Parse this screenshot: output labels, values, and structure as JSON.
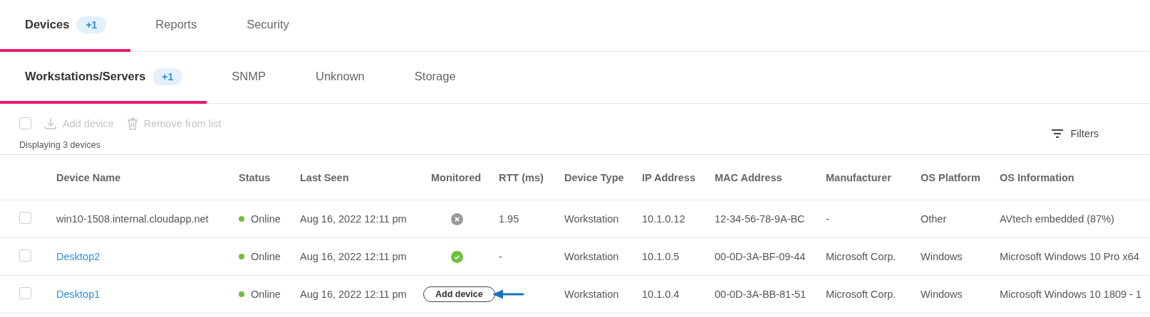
{
  "tabs": [
    {
      "label": "Devices",
      "badge": "+1",
      "selected": true
    },
    {
      "label": "Reports",
      "selected": false
    },
    {
      "label": "Security",
      "selected": false
    }
  ],
  "subtabs": [
    {
      "label": "Workstations/Servers",
      "badge": "+1",
      "selected": true
    },
    {
      "label": "SNMP",
      "selected": false
    },
    {
      "label": "Unknown",
      "selected": false
    },
    {
      "label": "Storage",
      "selected": false
    }
  ],
  "toolbar": {
    "select_all_checked": false,
    "actions": [
      {
        "kind": "add",
        "label": "Add device",
        "disabled": true
      },
      {
        "kind": "remove",
        "label": "Remove from list",
        "disabled": true
      }
    ],
    "count": "Displaying 3 devices",
    "filters": "Filters"
  },
  "table": {
    "columns": [
      "Device Name",
      "Status",
      "Last Seen",
      "Monitored",
      "RTT (ms)",
      "Device Type",
      "IP Address",
      "MAC Address",
      "Manufacturer",
      "OS Platform",
      "OS Information"
    ],
    "rows": [
      {
        "checked": false,
        "name": "win10-1508.internal.cloudapp.net",
        "link": false,
        "status": "Online",
        "last_seen": "Aug 16, 2022 12:11 pm",
        "monitored": {
          "kind": "not_monitored"
        },
        "rtt": "1.95",
        "device_type": "Workstation",
        "ip": "10.1.0.12",
        "mac": "12-34-56-78-9A-BC",
        "manufacturer": "-",
        "os_platform": "Other",
        "os_info": "AVtech embedded (87%)"
      },
      {
        "checked": false,
        "name": "Desktop2",
        "link": true,
        "status": "Online",
        "last_seen": "Aug 16, 2022 12:11 pm",
        "monitored": {
          "kind": "monitored"
        },
        "rtt": "-",
        "device_type": "Workstation",
        "ip": "10.1.0.5",
        "mac": "00-0D-3A-BF-09-44",
        "manufacturer": "Microsoft Corp.",
        "os_platform": "Windows",
        "os_info": "Microsoft Windows 10 Pro x64"
      },
      {
        "checked": false,
        "name": "Desktop1",
        "link": true,
        "status": "Online",
        "last_seen": "Aug 16, 2022 12:11 pm",
        "monitored": {
          "kind": "action",
          "label": "Add device",
          "arrow": true
        },
        "device_type": "Workstation",
        "ip": "10.1.0.4",
        "mac": "00-0D-3A-BB-81-51",
        "manufacturer": "Microsoft Corp.",
        "os_platform": "Windows",
        "os_info": "Microsoft Windows 10 1809 - 1"
      }
    ]
  }
}
